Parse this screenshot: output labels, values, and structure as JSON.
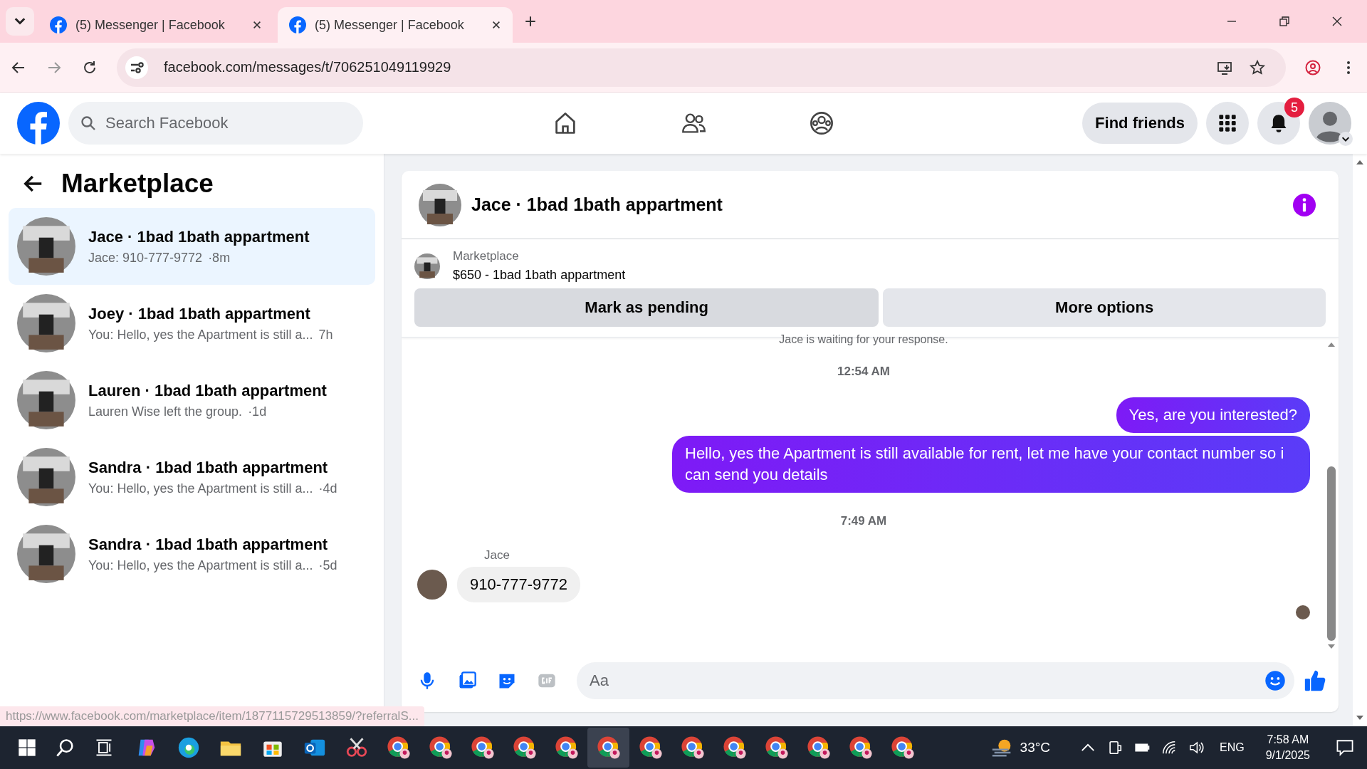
{
  "browser": {
    "tabs": [
      {
        "title": "(5) Messenger | Facebook",
        "selected": false
      },
      {
        "title": "(5) Messenger | Facebook",
        "selected": true
      }
    ],
    "address": "facebook.com/messages/t/706251049119929"
  },
  "header": {
    "search": {
      "placeholder": "Search Facebook"
    },
    "find_friends": "Find friends",
    "notification_count": "5"
  },
  "sidebar": {
    "title": "Marketplace",
    "conversations": [
      {
        "title": "Jace · 1bad 1bath appartment",
        "preview": "Jace: 910-777-9772",
        "time": "·8m",
        "selected": true
      },
      {
        "title": "Joey · 1bad 1bath appartment",
        "preview": "You: Hello, yes the Apartment is still a...",
        "time": "7h",
        "selected": false
      },
      {
        "title": "Lauren · 1bad 1bath appartment",
        "preview": "Lauren Wise left the group.",
        "time": "·1d",
        "selected": false
      },
      {
        "title": "Sandra · 1bad 1bath appartment",
        "preview": "You: Hello, yes the Apartment is still a...",
        "time": "·4d",
        "selected": false
      },
      {
        "title": "Sandra · 1bad 1bath appartment",
        "preview": "You: Hello, yes the Apartment is still a...",
        "time": "·5d",
        "selected": false
      }
    ]
  },
  "chat": {
    "title": "Jace · 1bad 1bath appartment",
    "listing": {
      "label": "Marketplace",
      "title": "$650 - 1bad 1bath appartment"
    },
    "buttons": [
      "Mark as pending",
      "More options"
    ],
    "messages": [
      {
        "kind": "notice",
        "text": "Jace is waiting for your response."
      },
      {
        "kind": "time",
        "text": "12:54 AM"
      },
      {
        "kind": "outgoing",
        "text": "Yes, are you interested?"
      },
      {
        "kind": "outgoing",
        "text": "Hello, yes the Apartment is still available for rent, let me have your contact number so i can send you details"
      },
      {
        "kind": "time",
        "text": "7:49 AM"
      },
      {
        "kind": "incoming",
        "sender": "Jace",
        "text": "910-777-9772"
      }
    ],
    "composer": {
      "placeholder": "Aa"
    }
  },
  "status_url": "https://www.facebook.com/marketplace/item/1877115729513859/?referralS...",
  "taskbar": {
    "apps": [
      {
        "kind": "copilot",
        "selected": false
      },
      {
        "kind": "edge",
        "selected": false
      },
      {
        "kind": "folder",
        "selected": false
      },
      {
        "kind": "store",
        "selected": false
      },
      {
        "kind": "mail",
        "selected": false
      },
      {
        "kind": "snip",
        "selected": false
      },
      {
        "kind": "chrome",
        "selected": false
      },
      {
        "kind": "chrome",
        "selected": false
      },
      {
        "kind": "chrome",
        "selected": false
      },
      {
        "kind": "chrome",
        "selected": false
      },
      {
        "kind": "chrome",
        "selected": false
      },
      {
        "kind": "chrome",
        "selected": true
      },
      {
        "kind": "chrome",
        "selected": false
      },
      {
        "kind": "chrome",
        "selected": false
      },
      {
        "kind": "chrome",
        "selected": false
      },
      {
        "kind": "chrome",
        "selected": false
      },
      {
        "kind": "chrome",
        "selected": false
      },
      {
        "kind": "chrome",
        "selected": false
      },
      {
        "kind": "chrome",
        "selected": false
      }
    ],
    "temperature": "33°C",
    "language": "ENG",
    "time": "7:58 AM",
    "date": "9/1/2025"
  }
}
